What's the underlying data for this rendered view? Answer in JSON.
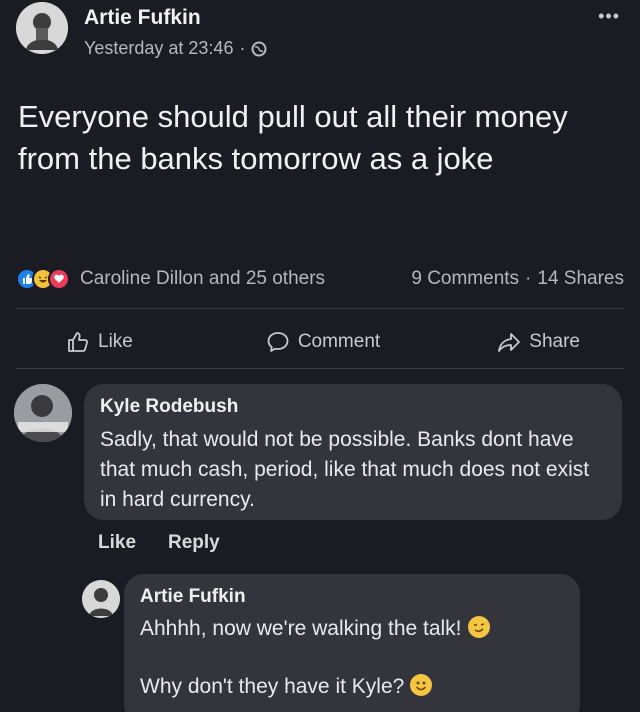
{
  "post": {
    "author": "Artie Fufkin",
    "time": "Yesterday at 23:46",
    "separator": "·",
    "more": "•••",
    "text": "Everyone should pull out all their money from the banks tomorrow as a joke"
  },
  "stats": {
    "reactions": "Caroline Dillon and 25 others",
    "comments": "9 Comments",
    "dot": "·",
    "shares": "14 Shares"
  },
  "actions": {
    "like": "Like",
    "comment": "Comment",
    "share": "Share"
  },
  "comments": [
    {
      "author": "Kyle Rodebush",
      "text": "Sadly, that would not be possible. Banks dont have that much cash, period, like that much does not exist in hard currency.",
      "like": "Like",
      "reply": "Reply"
    },
    {
      "author": "Artie Fufkin",
      "line1": "Ahhhh, now we're walking the talk!",
      "line2": "Why don't they have it Kyle?"
    }
  ],
  "colors": {
    "background": "#1b1b23",
    "bubble": "#33343c",
    "like_blue": "#1f7fe8",
    "love_red": "#ea3b59",
    "haha_yellow": "#f3c23d"
  },
  "icons": [
    "globe-icon",
    "like-thumb-icon",
    "comment-icon",
    "share-icon",
    "smile-emoji-icon",
    "wink-emoji-icon"
  ]
}
